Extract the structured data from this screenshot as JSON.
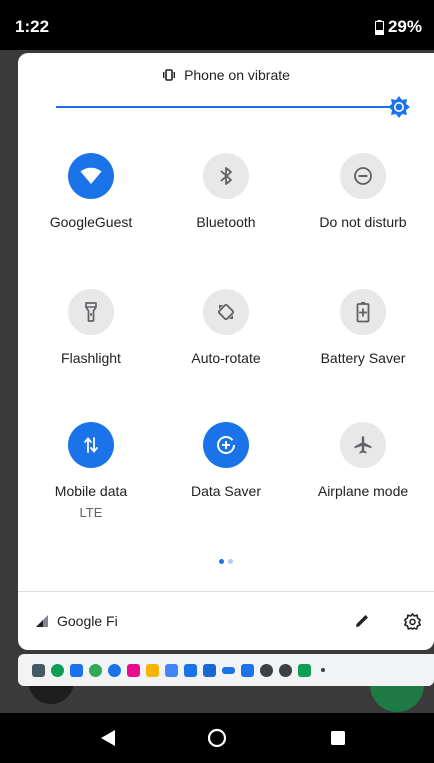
{
  "status_bar": {
    "time": "1:22",
    "battery": "29%"
  },
  "quick_settings": {
    "ringer_status": "Phone on vibrate",
    "tiles": [
      {
        "id": "wifi",
        "label": "GoogleGuest",
        "sublabel": "",
        "icon": "wifi-icon",
        "active": true
      },
      {
        "id": "bluetooth",
        "label": "Bluetooth",
        "sublabel": "",
        "icon": "bluetooth-icon",
        "active": false
      },
      {
        "id": "dnd",
        "label": "Do not disturb",
        "sublabel": "",
        "icon": "do-not-disturb-icon",
        "active": false
      },
      {
        "id": "flashlight",
        "label": "Flashlight",
        "sublabel": "",
        "icon": "flashlight-icon",
        "active": false
      },
      {
        "id": "autorotate",
        "label": "Auto-rotate",
        "sublabel": "",
        "icon": "auto-rotate-icon",
        "active": false
      },
      {
        "id": "battery-saver",
        "label": "Battery Saver",
        "sublabel": "",
        "icon": "battery-saver-icon",
        "active": false
      },
      {
        "id": "mobile-data",
        "label": "Mobile data",
        "sublabel": "LTE",
        "icon": "mobile-data-icon",
        "active": true
      },
      {
        "id": "data-saver",
        "label": "Data Saver",
        "sublabel": "",
        "icon": "data-saver-icon",
        "active": true
      },
      {
        "id": "airplane",
        "label": "Airplane mode",
        "sublabel": "",
        "icon": "airplane-icon",
        "active": false
      }
    ],
    "carrier": "Google Fi"
  },
  "notification_icons": [
    "photos-icon",
    "hangouts-icon",
    "calendar-icon",
    "maps-icon",
    "google-icon",
    "lyft-icon",
    "slides-icon",
    "docs-icon",
    "news-icon",
    "sports-icon",
    "voicemail-icon",
    "tasks-icon",
    "settings-app-icon",
    "check-icon",
    "play-store-icon",
    "more-dot-icon"
  ],
  "colors": {
    "accent": "#1a73e8",
    "tile_off": "#e8e8e8",
    "panel": "#ffffff"
  }
}
